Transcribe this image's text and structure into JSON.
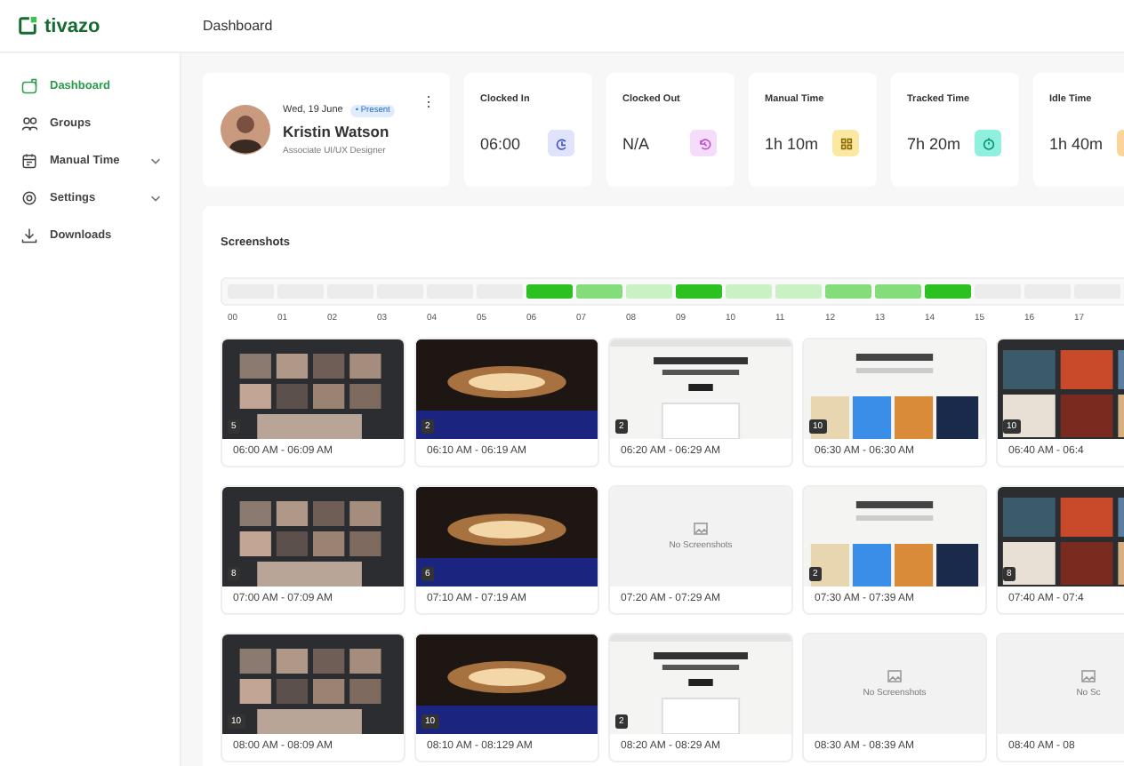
{
  "brand": {
    "name": "tivazo"
  },
  "header": {
    "title": "Dashboard"
  },
  "sidebar": {
    "items": [
      {
        "label": "Dashboard",
        "selected": true,
        "expandable": false
      },
      {
        "label": "Groups",
        "selected": false,
        "expandable": false
      },
      {
        "label": "Manual Time",
        "selected": false,
        "expandable": true
      },
      {
        "label": "Settings",
        "selected": false,
        "expandable": true
      },
      {
        "label": "Downloads",
        "selected": false,
        "expandable": false
      }
    ]
  },
  "profile": {
    "date": "Wed, 19 June",
    "status": "• Present",
    "name": "Kristin Watson",
    "role": "Associate UI/UX Designer",
    "menu": "⋮"
  },
  "stats": [
    {
      "label": "Clocked In",
      "value": "06:00",
      "color": "#dfe3fb"
    },
    {
      "label": "Clocked Out",
      "value": "N/A",
      "color": "#f6dcfb"
    },
    {
      "label": "Manual Time",
      "value": "1h 10m",
      "color": "#fbe9a3"
    },
    {
      "label": "Tracked Time",
      "value": "7h 20m",
      "color": "#8ff0de"
    },
    {
      "label": "Idle Time",
      "value": "1h 40m",
      "color": "#fbd49a"
    }
  ],
  "screenshots": {
    "title": "Screenshots",
    "hours": [
      {
        "label": "00",
        "color": "#ececec"
      },
      {
        "label": "01",
        "color": "#ececec"
      },
      {
        "label": "02",
        "color": "#ececec"
      },
      {
        "label": "03",
        "color": "#ececec"
      },
      {
        "label": "04",
        "color": "#ececec"
      },
      {
        "label": "05",
        "color": "#ececec"
      },
      {
        "label": "06",
        "color": "#2cc121"
      },
      {
        "label": "07",
        "color": "#84dc7a"
      },
      {
        "label": "08",
        "color": "#c9f1c3"
      },
      {
        "label": "09",
        "color": "#2cc121"
      },
      {
        "label": "10",
        "color": "#c9f1c3"
      },
      {
        "label": "11",
        "color": "#c9f1c3"
      },
      {
        "label": "12",
        "color": "#84dc7a"
      },
      {
        "label": "13",
        "color": "#84dc7a"
      },
      {
        "label": "14",
        "color": "#2cc121"
      },
      {
        "label": "15",
        "color": "#ececec"
      },
      {
        "label": "16",
        "color": "#ececec"
      },
      {
        "label": "17",
        "color": "#ececec"
      }
    ],
    "items": [
      {
        "kind": "picture",
        "count": "5",
        "time": "06:00 AM - 06:09 AM"
      },
      {
        "kind": "picture",
        "count": "2",
        "time": "06:10 AM - 06:19 AM"
      },
      {
        "kind": "picture",
        "count": "2",
        "time": "06:20 AM - 06:29 AM"
      },
      {
        "kind": "picture",
        "count": "10",
        "time": "06:30 AM - 06:30 AM"
      },
      {
        "kind": "picture",
        "count": "10",
        "time": "06:40 AM - 06:4"
      },
      {
        "kind": "picture",
        "count": "8",
        "time": "07:00 AM - 07:09 AM"
      },
      {
        "kind": "picture",
        "count": "6",
        "time": "07:10 AM - 07:19 AM"
      },
      {
        "kind": "empty",
        "message": "No Screenshots",
        "time": "07:20 AM - 07:29 AM"
      },
      {
        "kind": "picture",
        "count": "2",
        "time": "07:30 AM - 07:39 AM"
      },
      {
        "kind": "picture",
        "count": "8",
        "time": "07:40 AM - 07:4"
      },
      {
        "kind": "picture",
        "count": "10",
        "time": "08:00 AM - 08:09 AM"
      },
      {
        "kind": "picture",
        "count": "10",
        "time": "08:10 AM - 08:129 AM"
      },
      {
        "kind": "picture",
        "count": "2",
        "time": "08:20 AM - 08:29 AM"
      },
      {
        "kind": "empty",
        "message": "No Screenshots",
        "time": "08:30 AM - 08:39 AM"
      },
      {
        "kind": "empty",
        "message": "No Sc",
        "time": "08:40 AM - 08"
      }
    ]
  }
}
